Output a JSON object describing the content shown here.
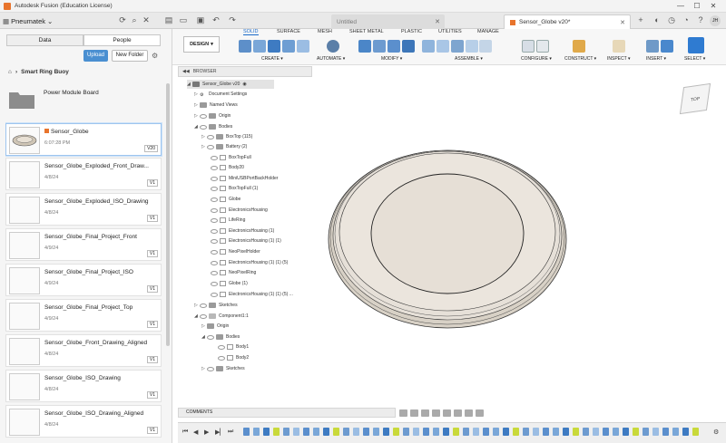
{
  "app": {
    "title": "Autodesk Fusion (Education License)",
    "user_initials": "JH"
  },
  "window_controls": {
    "minimize": "—",
    "maximize": "☐",
    "close": "✕"
  },
  "project": {
    "name": "Pneumatek"
  },
  "doc_tabs": [
    {
      "label": "Untitled",
      "active": false
    },
    {
      "label": "Sensor_Globe v20*",
      "active": true
    }
  ],
  "data_panel": {
    "tabs": [
      "Data",
      "People"
    ],
    "upload_label": "Upload",
    "new_folder_label": "New Folder",
    "breadcrumb": "Smart Ring Buoy",
    "items": [
      {
        "name": "Power Module Board",
        "date": "",
        "version": "",
        "kind": "folder"
      },
      {
        "name": "Sensor_Globe",
        "date": "6:07:28 PM",
        "version": "V20",
        "kind": "model",
        "selected": true
      },
      {
        "name": "Sensor_Globe_Exploded_Front_Draw...",
        "date": "4/8/24",
        "version": "V1",
        "kind": "drawing"
      },
      {
        "name": "Sensor_Globe_Exploded_ISO_Drawing",
        "date": "4/8/24",
        "version": "V1",
        "kind": "drawing"
      },
      {
        "name": "Sensor_Globe_Final_Project_Front",
        "date": "4/9/24",
        "version": "V1",
        "kind": "drawing"
      },
      {
        "name": "Sensor_Globe_Final_Project_ISO",
        "date": "4/9/24",
        "version": "V1",
        "kind": "drawing"
      },
      {
        "name": "Sensor_Globe_Final_Project_Top",
        "date": "4/9/24",
        "version": "V1",
        "kind": "drawing"
      },
      {
        "name": "Sensor_Globe_Front_Drawing_Aligned",
        "date": "4/8/24",
        "version": "V1",
        "kind": "drawing"
      },
      {
        "name": "Sensor_Globe_ISO_Drawing",
        "date": "4/8/24",
        "version": "V1",
        "kind": "drawing"
      },
      {
        "name": "Sensor_Globe_ISO_Drawing_Aligned",
        "date": "4/8/24",
        "version": "V1",
        "kind": "drawing"
      }
    ]
  },
  "toolbar": {
    "workspace": "DESIGN",
    "tabs": [
      "SOLID",
      "SURFACE",
      "MESH",
      "SHEET METAL",
      "PLASTIC",
      "UTILITIES",
      "MANAGE"
    ],
    "groups": [
      "CREATE ▾",
      "AUTOMATE ▾",
      "MODIFY ▾",
      "ASSEMBLE ▾",
      "CONFIGURE ▾",
      "CONSTRUCT ▾",
      "INSPECT ▾",
      "INSERT ▾",
      "SELECT ▾"
    ]
  },
  "browser": {
    "title": "BROWSER",
    "root": "Sensor_Globe v20",
    "nodes": [
      "Document Settings",
      "Named Views",
      "Origin",
      "Bodies",
      "BoxTop (115)",
      "Battery (2)",
      "BoxTopFull",
      "Body20",
      "MiniUSBPortBackHolder",
      "BoxTopFull (1)",
      "Globe",
      "ElectronicsHousing",
      "LifeRing",
      "ElectronicsHousing (1)",
      "ElectronicsHousing (1) (1)",
      "NeoPixelHolder",
      "ElectronicsHousing (1) (1) (5)",
      "NeoPixelRing",
      "Globe (1)",
      "ElectronicsHousing (1) (1) (5) ...",
      "Sketches",
      "Component1:1",
      "Origin",
      "Bodies",
      "Body1",
      "Body2",
      "Sketches"
    ]
  },
  "viewcube": {
    "face": "TOP"
  },
  "comments": {
    "label": "COMMENTS"
  },
  "colors": {
    "accent": "#1b6ac9",
    "body_fill": "#e6e0d8",
    "orange": "#e8742c"
  }
}
